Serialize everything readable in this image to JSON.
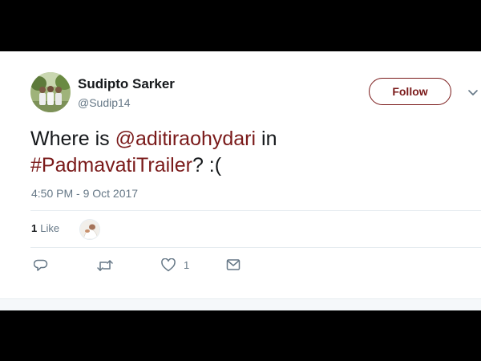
{
  "tweet": {
    "author": {
      "display_name": "Sudipto Sarker",
      "handle": "@Sudip14",
      "avatar_icon": "profile-photo-group"
    },
    "follow_label": "Follow",
    "text": {
      "prefix": "Where is ",
      "mention": "@aditiraohydari",
      "middle": " in",
      "hashtag": "#PadmavatiTrailer",
      "suffix": "? :("
    },
    "timestamp": "4:50 PM - 9 Oct 2017",
    "likes": {
      "count": "1",
      "label": "Like"
    },
    "actions": {
      "reply_icon": "reply-icon",
      "retweet_icon": "retweet-icon",
      "like_icon": "heart-icon",
      "like_count": "1",
      "dm_icon": "envelope-icon"
    }
  },
  "colors": {
    "accent": "#7a1a1a",
    "text": "#14171a",
    "muted": "#657786",
    "divider": "#e6ecf0",
    "frame": "#000000"
  }
}
